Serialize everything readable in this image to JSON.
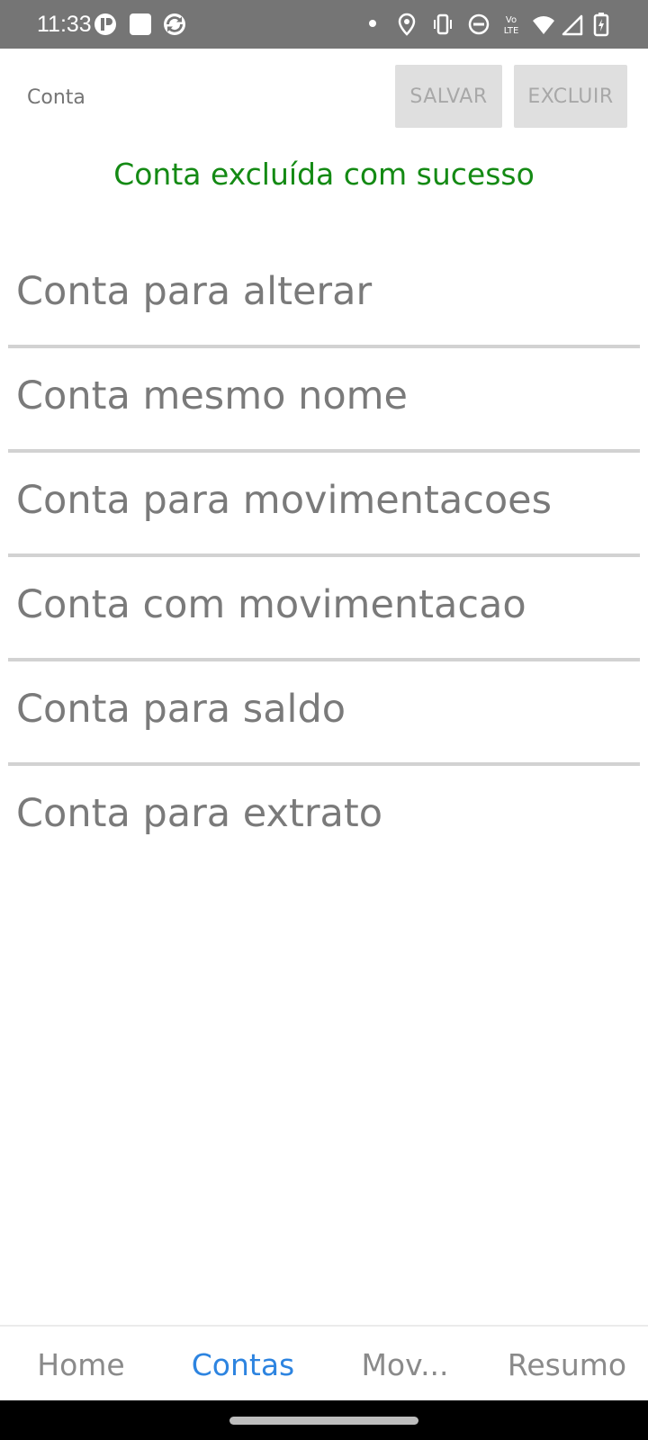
{
  "status_bar": {
    "time": "11:33",
    "icons": [
      "app-icon-1",
      "app-icon-square",
      "sync-icon",
      "dot-icon",
      "location-icon",
      "vibrate-icon",
      "do-not-disturb-icon",
      "volte-icon",
      "wifi-icon",
      "signal-icon",
      "battery-charging-icon"
    ]
  },
  "form": {
    "account_placeholder": "Conta",
    "save_label": "SALVAR",
    "delete_label": "EXCLUIR"
  },
  "message": "Conta excluída com sucesso",
  "accounts": [
    "Conta para alterar",
    "Conta mesmo nome",
    "Conta para movimentacoes",
    "Conta com movimentacao",
    "Conta para saldo",
    "Conta para extrato"
  ],
  "tabs": [
    {
      "label": "Home",
      "active": false
    },
    {
      "label": "Contas",
      "active": true
    },
    {
      "label": "Mov...",
      "active": false
    },
    {
      "label": "Resumo",
      "active": false
    }
  ],
  "colors": {
    "status_bar_bg": "#757575",
    "success_text": "#148a14",
    "active_tab": "#2d84e0",
    "button_bg": "#dfdfdf"
  }
}
